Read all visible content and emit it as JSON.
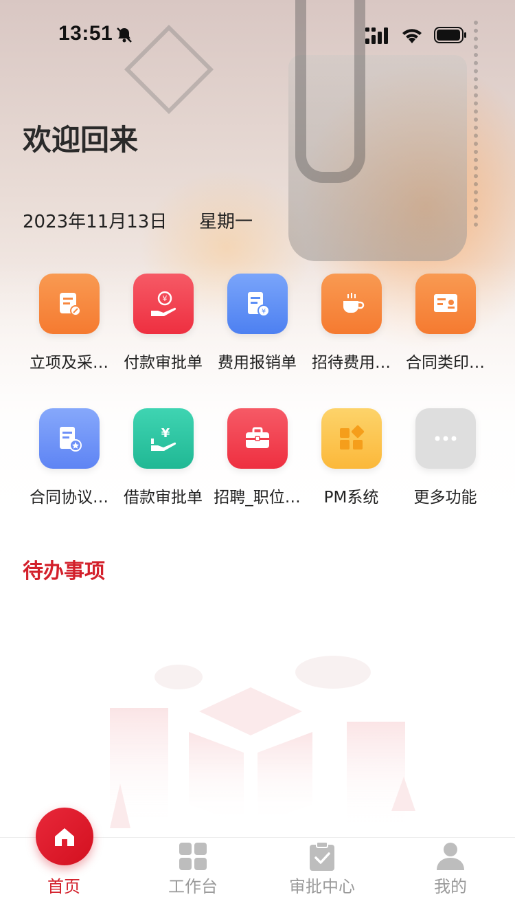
{
  "status_bar": {
    "time": "13:51"
  },
  "header": {
    "welcome": "欢迎回来",
    "date": "2023年11月13日",
    "weekday": "星期一"
  },
  "functions": [
    {
      "label": "立项及采…",
      "icon": "document-edit-icon",
      "color": "#f7873f"
    },
    {
      "label": "付款审批单",
      "icon": "hand-money-icon",
      "color": "#f03e4c"
    },
    {
      "label": "费用报销单",
      "icon": "receipt-yen-icon",
      "color": "#5b8ef5"
    },
    {
      "label": "招待费用…",
      "icon": "cup-icon",
      "color": "#f7873f"
    },
    {
      "label": "合同类印…",
      "icon": "certificate-icon",
      "color": "#f7873f"
    },
    {
      "label": "合同协议…",
      "icon": "contract-star-icon",
      "color": "#6d90f7"
    },
    {
      "label": "借款审批单",
      "icon": "hand-yen-icon",
      "color": "#2fc6a4"
    },
    {
      "label": "招聘_职位…",
      "icon": "briefcase-icon",
      "color": "#f03e4c"
    },
    {
      "label": "PM系统",
      "icon": "apps-icon",
      "color": "#fbc24a"
    },
    {
      "label": "更多功能",
      "icon": "more-icon",
      "color": "#dcdcdc"
    }
  ],
  "todo": {
    "title": "待办事项"
  },
  "tabbar": {
    "items": [
      {
        "label": "首页",
        "icon": "home-icon",
        "active": true
      },
      {
        "label": "工作台",
        "icon": "grid-icon",
        "active": false
      },
      {
        "label": "审批中心",
        "icon": "clipboard-check-icon",
        "active": false
      },
      {
        "label": "我的",
        "icon": "person-icon",
        "active": false
      }
    ]
  },
  "colors": {
    "accent": "#d3202b"
  }
}
